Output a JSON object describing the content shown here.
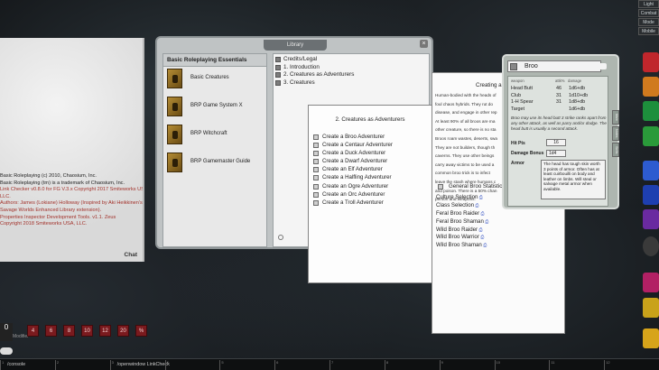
{
  "modes": [
    "Light",
    "Combat",
    "Mode",
    "Mobile"
  ],
  "chat": {
    "lines": [
      {
        "text": "Basic Roleplaying (c) 2010, Chaosium, Inc.",
        "red": false
      },
      {
        "text": "Basic Roleplaying (tm) is a trademark of Chaosium, Inc.",
        "red": false
      },
      {
        "text": "Link Checker v0.8.0 for FG V.3.x Copyright 2017 Smiteworks USA,",
        "red": true
      },
      {
        "text": "LLC.",
        "red": true
      },
      {
        "text": "Authors: James (Lokiane) Holloway (Inspired by Aki Heikkinen's",
        "red": true
      },
      {
        "text": "Savage Worlds Enhanced Library extension).",
        "red": true
      },
      {
        "text": "Properties Inspector Development Tools. v1.1. Zeus",
        "red": true
      },
      {
        "text": "Copyright 2018 Smiteworks USA, LLC.",
        "red": true
      }
    ],
    "label": "Chat"
  },
  "library": {
    "title": "Library",
    "close": "×",
    "left_header": "Basic Roleplaying Essentials",
    "modules": [
      "Basic Creatures",
      "BRP Game System X",
      "BRP Witchcraft",
      "BRP Gamemaster Guide"
    ],
    "toc": [
      "Credits/Legal",
      "1. Introduction",
      "2. Creatures as Adventurers",
      "3. Creatures"
    ]
  },
  "story": {
    "title": "Creating a Broo",
    "paragraphs": [
      "Human-bodied with the heads of",
      "foul chaos hybrids. They rut do",
      "disease, and engage in other rep",
      "At least 90% of all broos are ma",
      "other creature, so there is no sta",
      "Broos roam wastes, deserts, swa",
      "They are not builders, though th",
      "caverns. They use other beings",
      "carry away victims to be used a",
      "common broo trick is to infect",
      "leave the stash where humans c",
      "and poison. There is a 50% chan",
      "person and weapons."
    ]
  },
  "adventurers": {
    "title": "2. Creatures as Adventurers",
    "items": [
      "Create a Broo Adventurer",
      "Create a Centaur Adventurer",
      "Create a Duck Adventurer",
      "Create a Dwarf Adventurer",
      "Create an Elf Adventurer",
      "Create a Halfling Adventurer",
      "Create an Ogre Adventurer",
      "Create an Orc Adventurer",
      "Create a Troll Adventurer"
    ]
  },
  "broo_links": {
    "stats": "General Broo Statistics",
    "links": [
      "Culture Selection",
      "Class Selection",
      "Feral Broo Raider",
      "Feral Broo Shaman",
      "Wild Broo Raider",
      "Wild Broo Warrior",
      "Wild Broo Shaman"
    ]
  },
  "sheet": {
    "name": "Broo",
    "headers": {
      "weapon": "weapon",
      "attk": "attk%",
      "damage": "damage"
    },
    "weapons": [
      {
        "name": "Head Butt",
        "attk": "46",
        "damage": "1d6+db"
      },
      {
        "name": "Club",
        "attk": "31",
        "damage": "1d10+db"
      },
      {
        "name": "1-H Spear",
        "attk": "31",
        "damage": "1d8+db"
      },
      {
        "name": "Target",
        "attk": "",
        "damage": "1d6+db"
      }
    ],
    "note": "Broo may use its head butt 3 strike ranks apart from any other attack, as well as parry and/or dodge. The head butt is usually a second attack.",
    "hp_label": "Hit Pts",
    "hp": "16",
    "db_label": "Damage Bonus",
    "db": "1d4",
    "armor_label": "Armor",
    "armor": "The head has tough skin worth 3 points of armor. Often has at least cuirbouilli on body and leather on limbs. Will steal or salvage metal armor when available.",
    "side_tabs": [
      "Main",
      "Notes",
      "Skills"
    ]
  },
  "dice": [
    "4",
    "6",
    "8",
    "10",
    "12",
    "20",
    "%"
  ],
  "modifier": {
    "value": "0",
    "label": "Modifier"
  },
  "hotkeys": [
    {
      "num": "1",
      "label": "/console"
    },
    {
      "num": "2",
      "label": ""
    },
    {
      "num": "3",
      "label": "/openwindow LinkCheck"
    },
    {
      "num": "4",
      "label": ""
    },
    {
      "num": "5",
      "label": ""
    },
    {
      "num": "6",
      "label": ""
    },
    {
      "num": "7",
      "label": ""
    },
    {
      "num": "8",
      "label": ""
    },
    {
      "num": "9",
      "label": ""
    },
    {
      "num": "10",
      "label": ""
    },
    {
      "num": "11",
      "label": ""
    },
    {
      "num": "12",
      "label": ""
    }
  ],
  "colors": {
    "die": "#7a1a1e",
    "link": "#3a57c4",
    "chat_red": "#a3322b"
  }
}
